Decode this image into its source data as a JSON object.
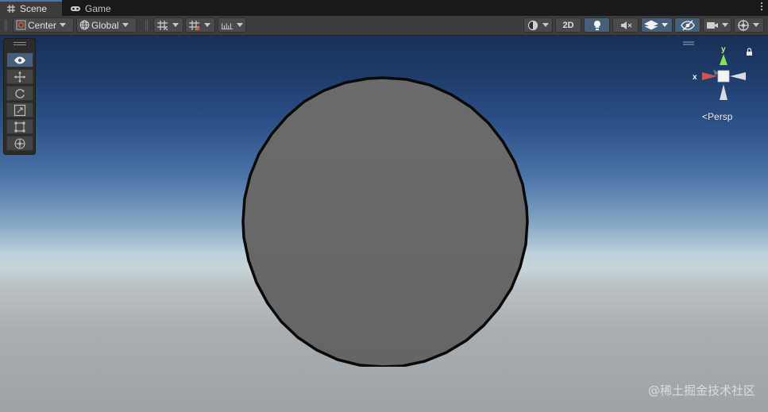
{
  "tabs": [
    {
      "label": "Scene",
      "icon": "grid-icon",
      "active": true
    },
    {
      "label": "Game",
      "icon": "gamepad-icon",
      "active": false
    }
  ],
  "toolbar": {
    "pivot_label": "Center",
    "space_label": "Global",
    "toggle_2d_label": "2D"
  },
  "tools": [
    {
      "name": "view-tool",
      "icon": "eye-icon",
      "active": true
    },
    {
      "name": "move-tool",
      "icon": "move-icon",
      "active": false
    },
    {
      "name": "rotate-tool",
      "icon": "rotate-icon",
      "active": false
    },
    {
      "name": "scale-tool",
      "icon": "scale-icon",
      "active": false
    },
    {
      "name": "rect-tool",
      "icon": "rect-icon",
      "active": false
    },
    {
      "name": "transform-tool",
      "icon": "transform-icon",
      "active": false
    }
  ],
  "gizmo": {
    "x_label": "x",
    "y_label": "y",
    "projection_label": "Persp"
  },
  "watermark": "@稀土掘金技术社区",
  "colors": {
    "active_tab_accent": "#3a79bb",
    "active_button": "#46607c",
    "sphere_fill": "#6a6a6a",
    "gizmo_x": "#d0554f",
    "gizmo_y": "#8ae04f"
  }
}
